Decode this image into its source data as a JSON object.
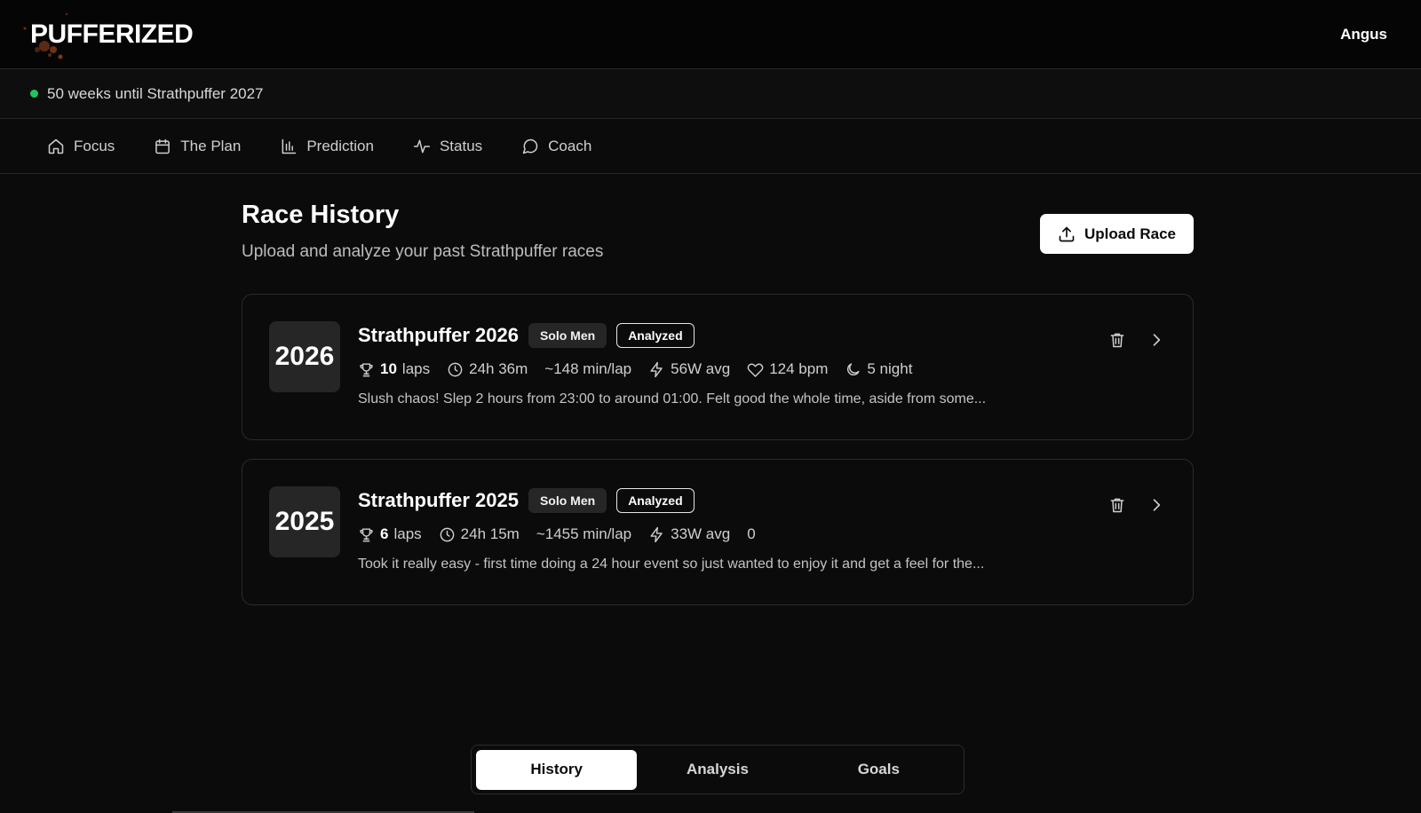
{
  "header": {
    "logo": "PUFFERIZED",
    "user": "Angus"
  },
  "countdown": {
    "text": "50 weeks until Strathpuffer 2027",
    "dot_color": "#22c55e"
  },
  "nav": {
    "items": [
      {
        "label": "Focus",
        "icon": "home-icon"
      },
      {
        "label": "The Plan",
        "icon": "calendar-icon"
      },
      {
        "label": "Prediction",
        "icon": "bar-chart-icon"
      },
      {
        "label": "Status",
        "icon": "activity-icon"
      },
      {
        "label": "Coach",
        "icon": "message-circle-icon"
      }
    ]
  },
  "page": {
    "title": "Race History",
    "subtitle": "Upload and analyze your past Strathpuffer races",
    "upload_label": "Upload Race"
  },
  "races": [
    {
      "year": "2026",
      "title": "Strathpuffer 2026",
      "category": "Solo Men",
      "status": "Analyzed",
      "laps_value": "10",
      "laps_unit": "laps",
      "duration": "24h 36m",
      "pace": "~148 min/lap",
      "power": "56W avg",
      "heart_rate": "124 bpm",
      "night": "5 night",
      "notes": "Slush chaos! Slep 2 hours from 23:00 to around 01:00. Felt good the whole time, aside from some..."
    },
    {
      "year": "2025",
      "title": "Strathpuffer 2025",
      "category": "Solo Men",
      "status": "Analyzed",
      "laps_value": "6",
      "laps_unit": "laps",
      "duration": "24h 15m",
      "pace": "~1455 min/lap",
      "power": "33W avg",
      "extra": "0",
      "notes": "Took it really easy - first time doing a 24 hour event so just wanted to enjoy it and get a feel for the..."
    }
  ],
  "tabs": {
    "items": [
      "History",
      "Analysis",
      "Goals"
    ],
    "active": "History"
  }
}
